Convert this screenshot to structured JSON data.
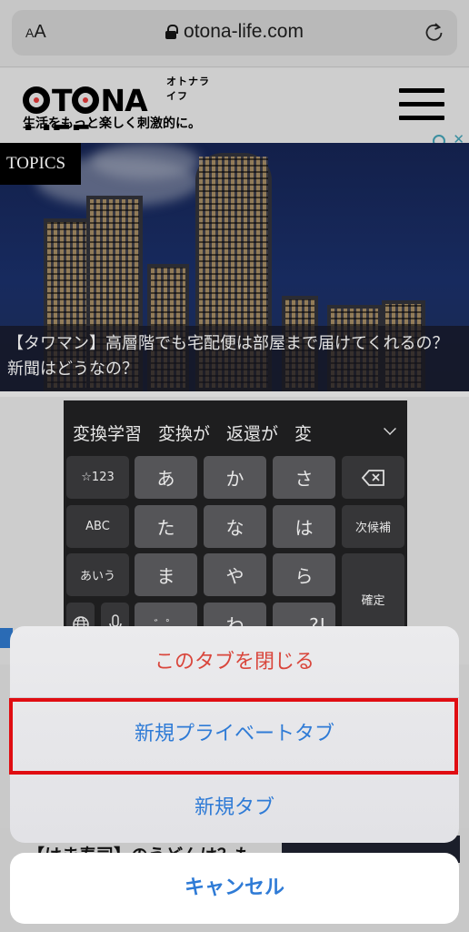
{
  "browser": {
    "text_size_label_small": "A",
    "text_size_label_large": "A",
    "url": "otona-life.com",
    "icons": {
      "lock": "lock-icon",
      "reload": "reload-icon"
    }
  },
  "site": {
    "logo_kana": "オトナライフ",
    "logo_text_part1": "T",
    "logo_text_part2": "NA LIFE",
    "tagline": "生活をもっと楽しく刺激的に。",
    "menu_icon": "hamburger-menu-icon"
  },
  "hero": {
    "badge": "TOPICS",
    "caption": "【タワマン】高層階でも宅配便は部屋まで届けてくれるの？　新聞はどうなの？"
  },
  "keyboard": {
    "candidates": [
      "変換学習",
      "変換が",
      "返還が",
      "変"
    ],
    "keys": {
      "numbers": "☆123",
      "a": "あ",
      "ka": "か",
      "sa": "さ",
      "abc": "ABC",
      "ta": "た",
      "na": "な",
      "ha": "は",
      "next_candidate": "次候補",
      "aiu": "あいう",
      "ma": "ま",
      "ya": "や",
      "ra": "ら",
      "confirm": "確定",
      "dakuten": "゛゜",
      "wa": "わ",
      "punct": "、。?!"
    }
  },
  "below_content": {
    "headline_partial": "【はま寿司】のうどんは？も"
  },
  "action_sheet": {
    "items": [
      {
        "label": "このタブを閉じる",
        "style": "destructive"
      },
      {
        "label": "新規プライベートタブ",
        "style": "default",
        "highlighted": true
      },
      {
        "label": "新規タブ",
        "style": "default"
      }
    ],
    "cancel_label": "キャンセル"
  },
  "colors": {
    "destructive": "#d9463c",
    "action_blue": "#2f7bd6",
    "highlight_border": "#e00d12"
  }
}
